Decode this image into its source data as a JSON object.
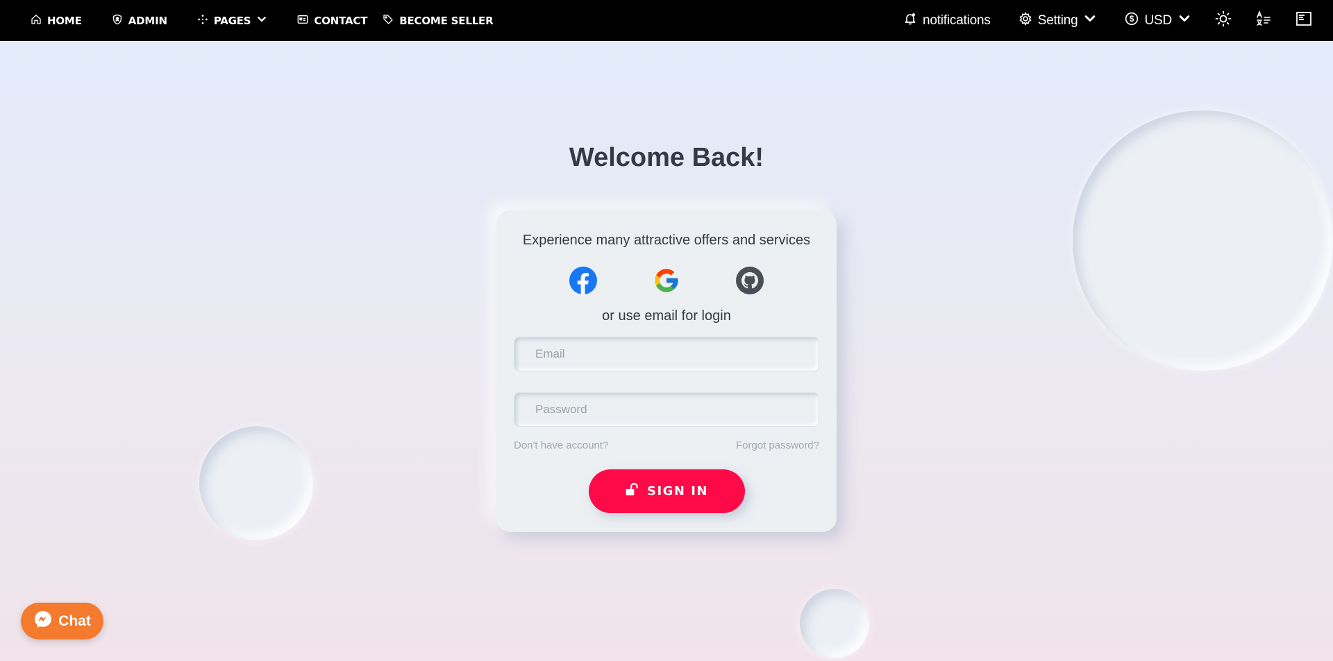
{
  "nav": {
    "left": [
      {
        "label": "HOME",
        "icon": "home-icon"
      },
      {
        "label": "ADMIN",
        "icon": "admin-shield-icon"
      },
      {
        "label": "PAGES",
        "icon": "pages-icon"
      },
      {
        "label": "CONTACT",
        "icon": "contact-card-icon"
      },
      {
        "label": "BECOME SELLER",
        "icon": "tag-icon"
      }
    ],
    "right": {
      "notifications_label": "notifications",
      "setting_label": "Setting",
      "currency_label": "USD"
    }
  },
  "login": {
    "heading": "Welcome Back!",
    "subtitle": "Experience many attractive offers and services",
    "social_providers": [
      "facebook",
      "google",
      "github"
    ],
    "alt_text": "or use email for login",
    "email_placeholder": "Email",
    "password_placeholder": "Password",
    "no_account_link": "Don't have account?",
    "forgot_link": "Forgot password?",
    "signin_label": "SIGN IN"
  },
  "chat": {
    "label": "Chat"
  },
  "colors": {
    "nav_bg": "#000000",
    "primary_button": "#fe0a48",
    "chat_button": "#f47a2e",
    "card_bg": "#ecf0f3"
  }
}
